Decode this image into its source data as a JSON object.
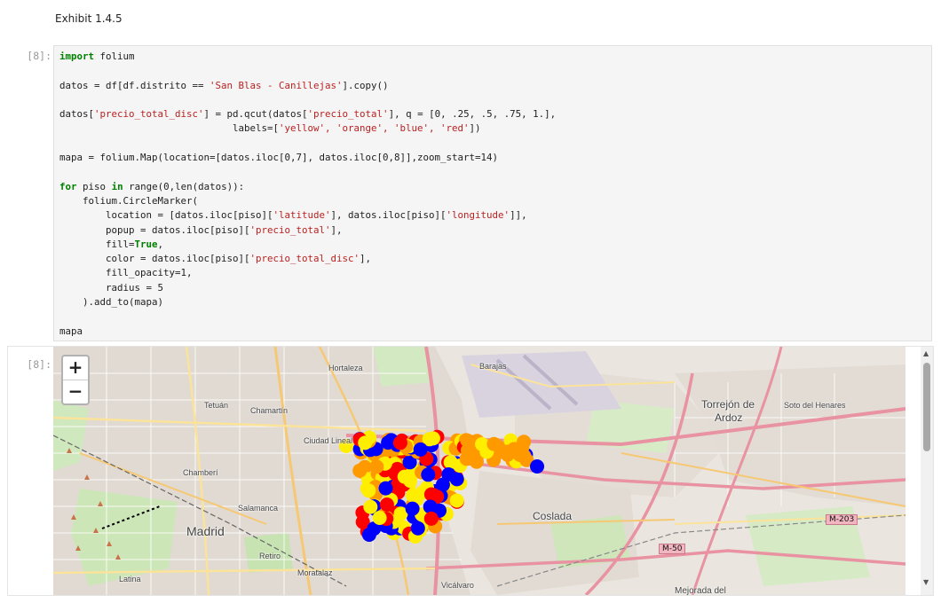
{
  "markdown": {
    "text": "Exhibit 1.4.5"
  },
  "input_cell": {
    "prompt": "[8]:",
    "code": {
      "line1": "folium",
      "line3_a": "datos = df[df.distrito == ",
      "line3_str": "'San Blas - Canillejas'",
      "line3_b": "].copy()",
      "line5_str1": "'precio_total_disc'",
      "line5_mid": "] = pd.qcut(datos[",
      "line5_str2": "'precio_total'",
      "line5_end": "], q = [0, .25, .5, .75, 1.],",
      "line6_pre": "                              labels=[",
      "line6_labels": "'yellow', 'orange', 'blue', 'red'",
      "line6_end": "])",
      "line8": "mapa = folium.Map(location=[datos.iloc[0,7], datos.iloc[0,8]],zoom_start=14)",
      "line10_a": "piso",
      "line10_b": "range(0,len(datos)):",
      "line11": "    folium.CircleMarker(",
      "line12_a": "        location = [datos.iloc[piso][",
      "line12_s1": "'latitude'",
      "line12_m": "], datos.iloc[piso][",
      "line12_s2": "'longitude'",
      "line12_e": "]],",
      "line13_a": "        popup = datos.iloc[piso][",
      "line13_s": "'precio_total'",
      "line13_e": "],",
      "line14_a": "        fill=",
      "line14_b": "True",
      "line15_a": "        color = datos.iloc[piso][",
      "line15_s": "'precio_total_disc'",
      "line15_e": "],",
      "line16": "        fill_opacity=1,",
      "line17": "        radius = 5",
      "line18": "    ).add_to(mapa)",
      "line20": "mapa"
    }
  },
  "output_cell": {
    "prompt": "[8]:",
    "zoom_in": "+",
    "zoom_out": "−",
    "scroll_up": "▲",
    "scroll_down": "▼"
  },
  "map_labels": {
    "madrid": "Madrid",
    "coslada": "Coslada",
    "torrejon1": "Torrejón de",
    "torrejon2": "Ardoz",
    "soto": "Soto del Henares",
    "tetuan": "Tetuán",
    "chamartin": "Chamartín",
    "chamberi": "Chamberí",
    "salamanca": "Salamanca",
    "retiro": "Retiro",
    "latina": "Latina",
    "moratalaz": "Moratalaz",
    "vicalvaro": "Vicálvaro",
    "hortaleza": "Hortaleza",
    "barajas": "Barajas",
    "ciudad_lineal": "Ciudad Lineal",
    "mejorada": "Mejorada del",
    "m203": "M-203",
    "m50": "M-50"
  },
  "map_data": {
    "marker_colors": {
      "yellow": "#ffee00",
      "orange": "#ff9900",
      "blue": "#0000ff",
      "red": "#ff0000"
    }
  }
}
